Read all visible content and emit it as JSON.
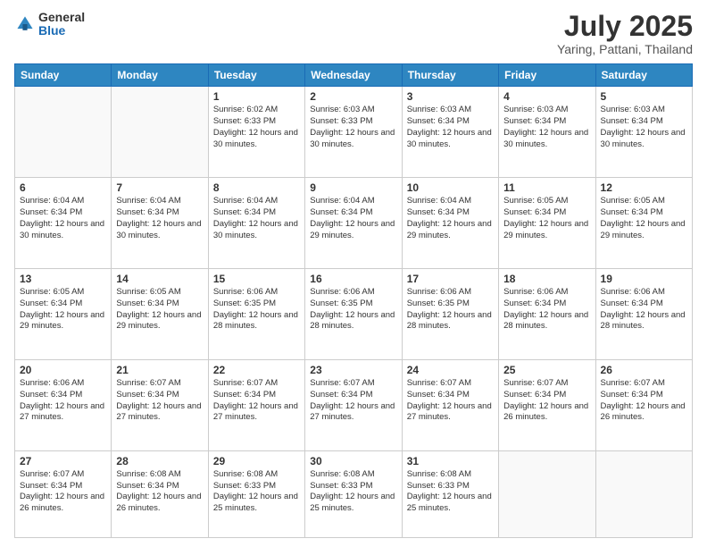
{
  "logo": {
    "general": "General",
    "blue": "Blue"
  },
  "title": "July 2025",
  "subtitle": "Yaring, Pattani, Thailand",
  "days_header": [
    "Sunday",
    "Monday",
    "Tuesday",
    "Wednesday",
    "Thursday",
    "Friday",
    "Saturday"
  ],
  "weeks": [
    [
      {
        "day": "",
        "info": ""
      },
      {
        "day": "",
        "info": ""
      },
      {
        "day": "1",
        "info": "Sunrise: 6:02 AM\nSunset: 6:33 PM\nDaylight: 12 hours and 30 minutes."
      },
      {
        "day": "2",
        "info": "Sunrise: 6:03 AM\nSunset: 6:33 PM\nDaylight: 12 hours and 30 minutes."
      },
      {
        "day": "3",
        "info": "Sunrise: 6:03 AM\nSunset: 6:34 PM\nDaylight: 12 hours and 30 minutes."
      },
      {
        "day": "4",
        "info": "Sunrise: 6:03 AM\nSunset: 6:34 PM\nDaylight: 12 hours and 30 minutes."
      },
      {
        "day": "5",
        "info": "Sunrise: 6:03 AM\nSunset: 6:34 PM\nDaylight: 12 hours and 30 minutes."
      }
    ],
    [
      {
        "day": "6",
        "info": "Sunrise: 6:04 AM\nSunset: 6:34 PM\nDaylight: 12 hours and 30 minutes."
      },
      {
        "day": "7",
        "info": "Sunrise: 6:04 AM\nSunset: 6:34 PM\nDaylight: 12 hours and 30 minutes."
      },
      {
        "day": "8",
        "info": "Sunrise: 6:04 AM\nSunset: 6:34 PM\nDaylight: 12 hours and 30 minutes."
      },
      {
        "day": "9",
        "info": "Sunrise: 6:04 AM\nSunset: 6:34 PM\nDaylight: 12 hours and 29 minutes."
      },
      {
        "day": "10",
        "info": "Sunrise: 6:04 AM\nSunset: 6:34 PM\nDaylight: 12 hours and 29 minutes."
      },
      {
        "day": "11",
        "info": "Sunrise: 6:05 AM\nSunset: 6:34 PM\nDaylight: 12 hours and 29 minutes."
      },
      {
        "day": "12",
        "info": "Sunrise: 6:05 AM\nSunset: 6:34 PM\nDaylight: 12 hours and 29 minutes."
      }
    ],
    [
      {
        "day": "13",
        "info": "Sunrise: 6:05 AM\nSunset: 6:34 PM\nDaylight: 12 hours and 29 minutes."
      },
      {
        "day": "14",
        "info": "Sunrise: 6:05 AM\nSunset: 6:34 PM\nDaylight: 12 hours and 29 minutes."
      },
      {
        "day": "15",
        "info": "Sunrise: 6:06 AM\nSunset: 6:35 PM\nDaylight: 12 hours and 28 minutes."
      },
      {
        "day": "16",
        "info": "Sunrise: 6:06 AM\nSunset: 6:35 PM\nDaylight: 12 hours and 28 minutes."
      },
      {
        "day": "17",
        "info": "Sunrise: 6:06 AM\nSunset: 6:35 PM\nDaylight: 12 hours and 28 minutes."
      },
      {
        "day": "18",
        "info": "Sunrise: 6:06 AM\nSunset: 6:34 PM\nDaylight: 12 hours and 28 minutes."
      },
      {
        "day": "19",
        "info": "Sunrise: 6:06 AM\nSunset: 6:34 PM\nDaylight: 12 hours and 28 minutes."
      }
    ],
    [
      {
        "day": "20",
        "info": "Sunrise: 6:06 AM\nSunset: 6:34 PM\nDaylight: 12 hours and 27 minutes."
      },
      {
        "day": "21",
        "info": "Sunrise: 6:07 AM\nSunset: 6:34 PM\nDaylight: 12 hours and 27 minutes."
      },
      {
        "day": "22",
        "info": "Sunrise: 6:07 AM\nSunset: 6:34 PM\nDaylight: 12 hours and 27 minutes."
      },
      {
        "day": "23",
        "info": "Sunrise: 6:07 AM\nSunset: 6:34 PM\nDaylight: 12 hours and 27 minutes."
      },
      {
        "day": "24",
        "info": "Sunrise: 6:07 AM\nSunset: 6:34 PM\nDaylight: 12 hours and 27 minutes."
      },
      {
        "day": "25",
        "info": "Sunrise: 6:07 AM\nSunset: 6:34 PM\nDaylight: 12 hours and 26 minutes."
      },
      {
        "day": "26",
        "info": "Sunrise: 6:07 AM\nSunset: 6:34 PM\nDaylight: 12 hours and 26 minutes."
      }
    ],
    [
      {
        "day": "27",
        "info": "Sunrise: 6:07 AM\nSunset: 6:34 PM\nDaylight: 12 hours and 26 minutes."
      },
      {
        "day": "28",
        "info": "Sunrise: 6:08 AM\nSunset: 6:34 PM\nDaylight: 12 hours and 26 minutes."
      },
      {
        "day": "29",
        "info": "Sunrise: 6:08 AM\nSunset: 6:33 PM\nDaylight: 12 hours and 25 minutes."
      },
      {
        "day": "30",
        "info": "Sunrise: 6:08 AM\nSunset: 6:33 PM\nDaylight: 12 hours and 25 minutes."
      },
      {
        "day": "31",
        "info": "Sunrise: 6:08 AM\nSunset: 6:33 PM\nDaylight: 12 hours and 25 minutes."
      },
      {
        "day": "",
        "info": ""
      },
      {
        "day": "",
        "info": ""
      }
    ]
  ]
}
